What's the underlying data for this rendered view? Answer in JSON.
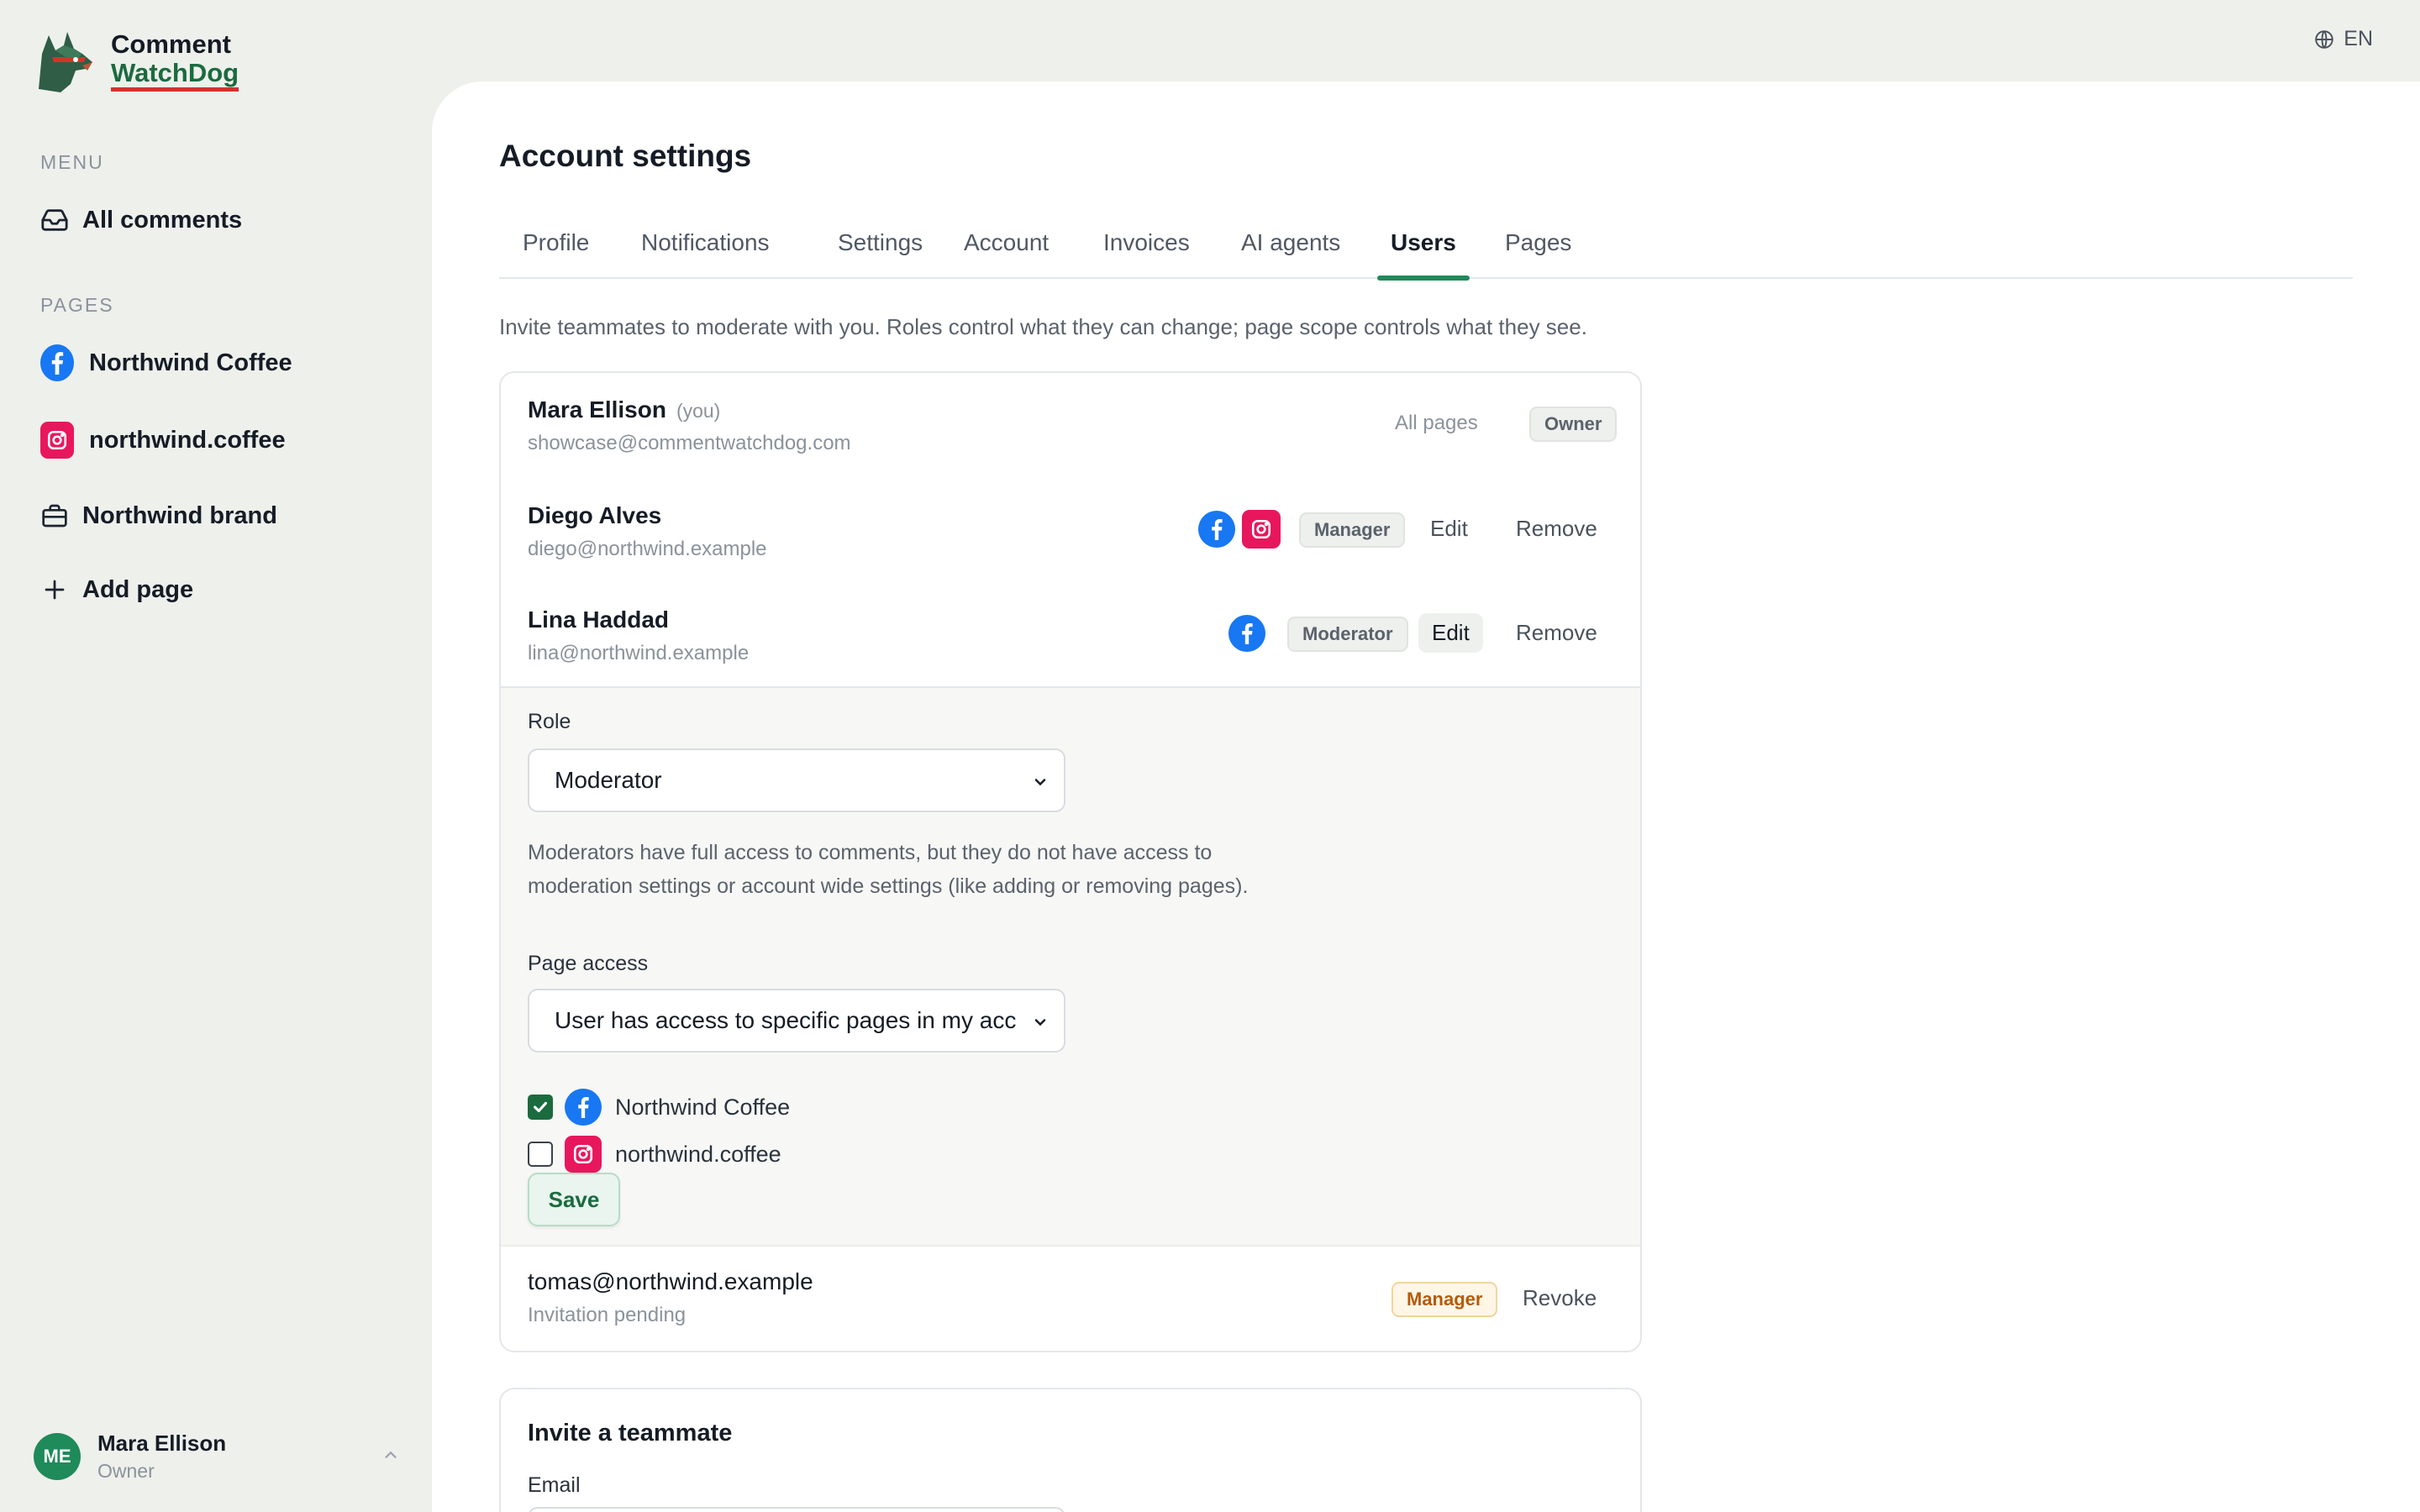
{
  "brand": {
    "line1": "Comment",
    "line2": "WatchDog"
  },
  "language": "EN",
  "sidebar": {
    "menu_label": "MENU",
    "all_comments": "All comments",
    "pages_label": "PAGES",
    "pages": [
      {
        "label": "Northwind Coffee",
        "icon": "facebook-icon"
      },
      {
        "label": "northwind.coffee",
        "icon": "instagram-icon"
      },
      {
        "label": "Northwind brand",
        "icon": "briefcase-icon"
      }
    ],
    "add_page": "Add page",
    "user": {
      "initials": "ME",
      "name": "Mara Ellison",
      "role": "Owner"
    }
  },
  "main": {
    "title": "Account settings",
    "tabs": [
      "Profile",
      "Notifications",
      "Settings",
      "Account",
      "Invoices",
      "AI agents",
      "Users",
      "Pages"
    ],
    "active_tab": "Users",
    "intro": "Invite teammates to moderate with you. Roles control what they can change; page scope controls what they see."
  },
  "users": [
    {
      "name": "Mara Ellison",
      "you": "(you)",
      "email": "showcase@commentwatchdog.com",
      "scope": "All pages",
      "role": "Owner"
    },
    {
      "name": "Diego Alves",
      "email": "diego@northwind.example",
      "role": "Manager",
      "edit": "Edit",
      "remove": "Remove"
    },
    {
      "name": "Lina Haddad",
      "email": "lina@northwind.example",
      "role": "Moderator",
      "edit": "Edit",
      "remove": "Remove"
    }
  ],
  "edit_form": {
    "role_label": "Role",
    "role_value": "Moderator",
    "role_help": "Moderators have full access to comments, but they do not have access to moderation settings or account wide settings (like adding or removing pages).",
    "access_label": "Page access",
    "access_value": "User has access to specific pages in my acc",
    "pages": [
      {
        "label": "Northwind Coffee",
        "checked": true
      },
      {
        "label": "northwind.coffee",
        "checked": false
      }
    ],
    "save": "Save"
  },
  "invitation": {
    "email": "tomas@northwind.example",
    "status": "Invitation pending",
    "role": "Manager",
    "revoke": "Revoke"
  },
  "invite": {
    "title": "Invite a teammate",
    "email_label": "Email"
  },
  "colors": {
    "accent": "#1f8a5a",
    "facebook": "#1877f2",
    "instagram": "#e8175d",
    "warn": "#b45b09"
  }
}
